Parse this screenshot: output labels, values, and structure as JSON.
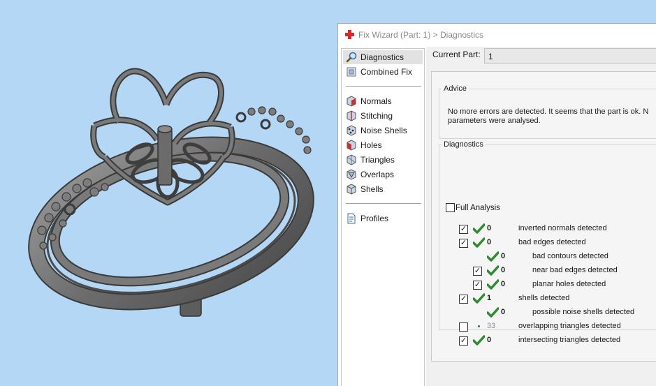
{
  "window": {
    "title": "Fix Wizard (Part: 1) > Diagnostics"
  },
  "sidebar": {
    "groups": [
      [
        {
          "label": "Diagnostics",
          "icon": "magnifier-icon",
          "selected": true
        },
        {
          "label": "Combined Fix",
          "icon": "cubes-icon"
        }
      ],
      [
        {
          "label": "Normals",
          "icon": "normals-icon"
        },
        {
          "label": "Stitching",
          "icon": "stitching-icon"
        },
        {
          "label": "Noise Shells",
          "icon": "noise-shells-icon"
        },
        {
          "label": "Holes",
          "icon": "holes-icon"
        },
        {
          "label": "Triangles",
          "icon": "triangles-icon"
        },
        {
          "label": "Overlaps",
          "icon": "overlaps-icon"
        },
        {
          "label": "Shells",
          "icon": "shells-icon"
        }
      ],
      [
        {
          "label": "Profiles",
          "icon": "document-icon"
        }
      ]
    ]
  },
  "current_part": {
    "label": "Current Part:",
    "value": "1"
  },
  "advice": {
    "legend": "Advice",
    "text": "No more errors are detected. It seems that the part is ok. N parameters were analysed."
  },
  "diagnostics": {
    "legend": "Diagnostics",
    "full_analysis": {
      "label": "Full Analysis",
      "checked": false
    },
    "rows": [
      {
        "checkbox": true,
        "checked": true,
        "status": "ok",
        "count": "0",
        "label": "inverted normals detected",
        "indent": 0
      },
      {
        "checkbox": true,
        "checked": true,
        "status": "ok",
        "count": "0",
        "label": "bad edges detected",
        "indent": 0
      },
      {
        "checkbox": false,
        "status": "ok",
        "count": "0",
        "label": "bad contours detected",
        "indent": 1
      },
      {
        "checkbox": true,
        "checked": true,
        "status": "ok",
        "count": "0",
        "label": "near bad edges detected",
        "indent": 1
      },
      {
        "checkbox": true,
        "checked": true,
        "status": "ok",
        "count": "0",
        "label": "planar holes detected",
        "indent": 1
      },
      {
        "checkbox": true,
        "checked": true,
        "status": "ok",
        "count": "1",
        "label": "shells detected",
        "indent": 0
      },
      {
        "checkbox": false,
        "status": "ok",
        "count": "0",
        "label": "possible noise shells detected",
        "indent": 1
      },
      {
        "checkbox": true,
        "checked": false,
        "status": "info",
        "count": "33",
        "label": "overlapping triangles detected",
        "indent": 0
      },
      {
        "checkbox": true,
        "checked": true,
        "status": "ok",
        "count": "0",
        "label": "intersecting triangles detected",
        "indent": 0
      }
    ]
  },
  "colors": {
    "viewport_bg": "#b3d7f5",
    "model_metal": "#6f6f6f",
    "status_ok": "#2e8b2e",
    "status_info": "#2f5fa0"
  }
}
